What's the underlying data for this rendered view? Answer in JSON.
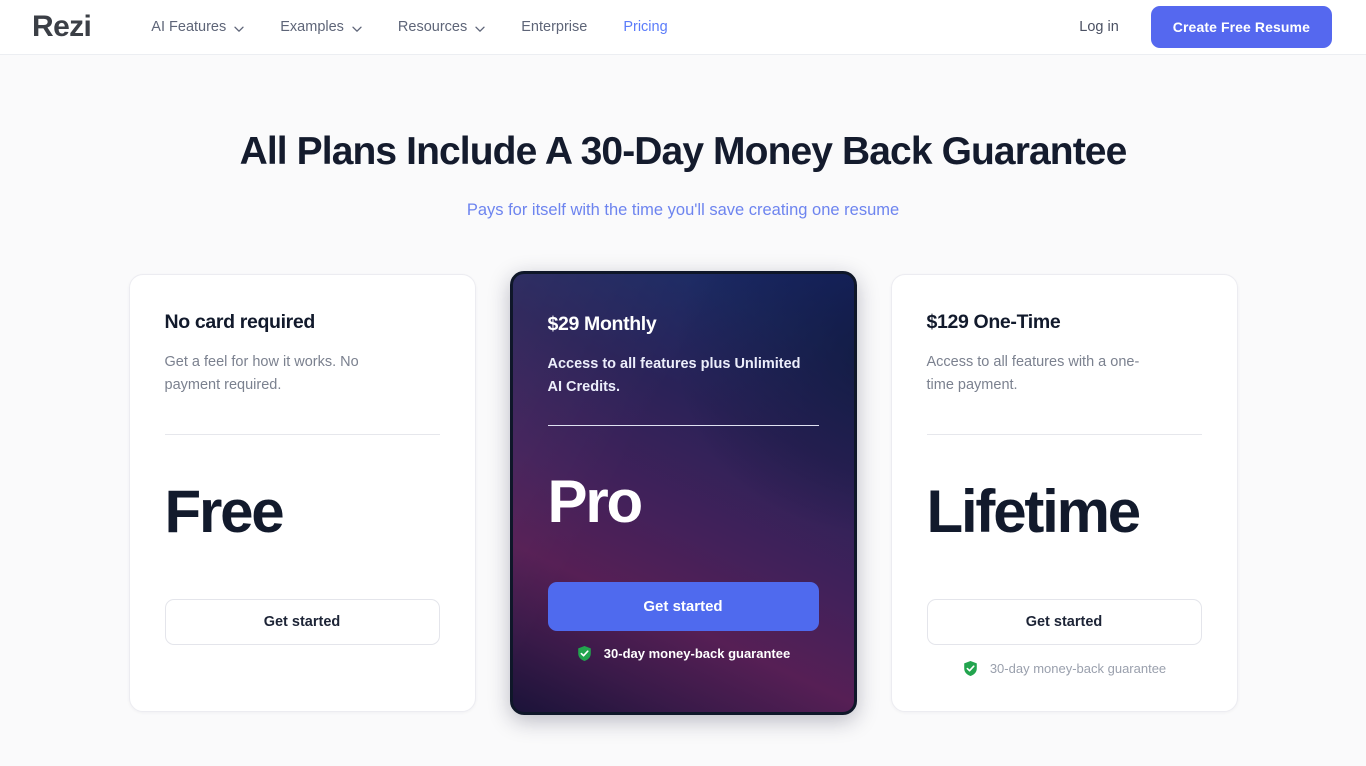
{
  "header": {
    "brand": "Rezi",
    "nav": [
      {
        "label": "AI Features",
        "has_chevron": true,
        "active": false,
        "icon": "chevron-down-icon"
      },
      {
        "label": "Examples",
        "has_chevron": true,
        "active": false,
        "icon": "chevron-down-icon"
      },
      {
        "label": "Resources",
        "has_chevron": true,
        "active": false,
        "icon": "chevron-down-icon"
      },
      {
        "label": "Enterprise",
        "has_chevron": false,
        "active": false,
        "icon": ""
      },
      {
        "label": "Pricing",
        "has_chevron": false,
        "active": true,
        "icon": ""
      }
    ],
    "login_label": "Log in",
    "cta_label": "Create Free Resume",
    "accent_color": "#5568ef",
    "active_link_color": "#5b7cfa"
  },
  "hero": {
    "title": "All Plans Include A 30-Day Money Back Guarantee",
    "subtitle": "Pays for itself with the time you'll save creating one resume",
    "subtitle_color": "#6d84ef"
  },
  "plans": [
    {
      "id": "free",
      "eyebrow": "No card required",
      "description": "Get a feel for how it works. No payment required.",
      "name": "Free",
      "cta_label": "Get started",
      "featured": false,
      "guarantee": null,
      "guarantee_icon": null
    },
    {
      "id": "pro",
      "eyebrow": "$29 Monthly",
      "description": "Access to all features plus Unlimited AI Credits.",
      "name": "Pro",
      "cta_label": "Get started",
      "featured": true,
      "guarantee": "30-day money-back guarantee",
      "guarantee_icon": "shield-check-icon",
      "guarantee_icon_color": "#22a44e",
      "cta_color": "#4f6aee",
      "gradient_from": "#17276a",
      "gradient_mid": "#561f55",
      "gradient_to": "#1b1339"
    },
    {
      "id": "lifetime",
      "eyebrow": "$129 One-Time",
      "description": "Access to all features with a one-time payment.",
      "name": "Lifetime",
      "cta_label": "Get started",
      "featured": false,
      "guarantee": "30-day money-back guarantee",
      "guarantee_icon": "shield-check-icon",
      "guarantee_icon_color": "#22a44e"
    }
  ]
}
